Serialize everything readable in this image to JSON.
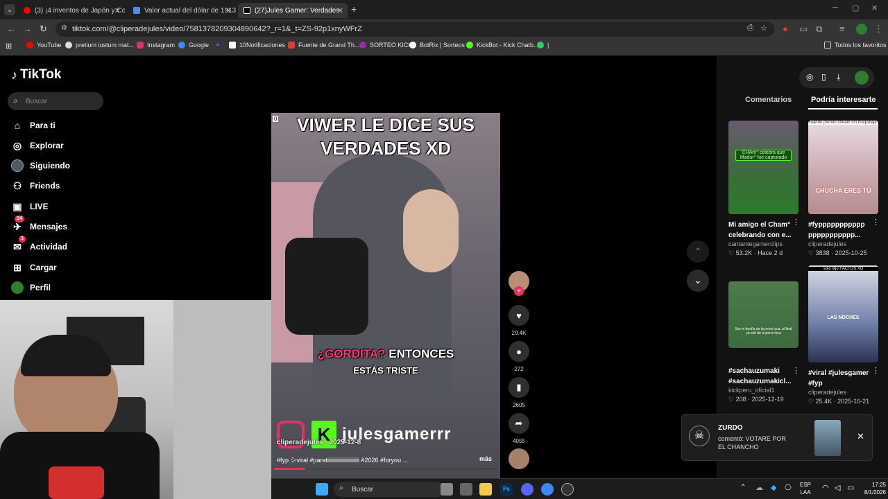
{
  "browser": {
    "tabs": [
      {
        "label": "(3) ¡4 inventos de Japón y Core",
        "color": "#ff0000"
      },
      {
        "label": "Valor actual del dólar de 1913",
        "color": "#4a90e2"
      },
      {
        "label": "(27)Jules Gamer: Verdades",
        "color": "#ffffff"
      }
    ],
    "url": "tiktok.com/@cliperadejules/video/7581378209304890642?_r=1&_t=ZS-92p1xnyWFrZ",
    "bookmarks": [
      {
        "label": "YouTube",
        "color": "#ff0000"
      },
      {
        "label": "pretium iustum mat...",
        "color": "#dddddd"
      },
      {
        "label": "Instagram",
        "color": "#e1306c"
      },
      {
        "label": "Google",
        "color": "#4285f4"
      },
      {
        "label": "10Notificaciones",
        "color": "#ffffff"
      },
      {
        "label": "Fuente de Grand Th...",
        "color": "#e53935"
      },
      {
        "label": "SORTEO KICK",
        "color": "#9c27b0"
      },
      {
        "label": "BotRix | Sorteos",
        "color": "#ffffff"
      },
      {
        "label": "KickBot - Kick Chatb...",
        "color": "#53fc18"
      }
    ],
    "all_favorites": "Todos los favoritos"
  },
  "tiktok": {
    "logo": "TikTok",
    "search_placeholder": "Buscar",
    "sidebar": [
      {
        "label": "Para ti",
        "icon": "home-icon"
      },
      {
        "label": "Explorar",
        "icon": "compass-icon"
      },
      {
        "label": "Siguiendo",
        "icon": "avatar-icon"
      },
      {
        "label": "Friends",
        "icon": "friends-icon"
      },
      {
        "label": "LIVE",
        "icon": "live-icon"
      },
      {
        "label": "Mensajes",
        "icon": "messages-icon",
        "badge": "24"
      },
      {
        "label": "Actividad",
        "icon": "activity-icon",
        "badge": "3"
      },
      {
        "label": "Cargar",
        "icon": "upload-icon"
      },
      {
        "label": "Perfil",
        "icon": "profile-icon"
      }
    ],
    "video": {
      "caption_top": "VIWER LE DICE SUS VERDADES XD",
      "caption_mid_accent": "¿GORDITA?",
      "caption_mid": "ENTONCES",
      "caption_sub": "ESTÁS TRISTE",
      "watermark": "julesgamerrr",
      "author": "cliperadejules · 2025-12-8",
      "description": "#fyp シviral #paratiiiiiiiiiiiiiiiiiiiiiii #2026 #foryou ...",
      "more": "más",
      "corner": "0"
    },
    "actions": {
      "likes": "29.4K",
      "comments": "272",
      "saves": "2605",
      "shares": "4055"
    },
    "panel": {
      "tab_comments": "Comentarios",
      "tab_interest": "Podría interesarte",
      "cards": [
        {
          "title": "Mi amigo el Cham° celebrando con e...",
          "author": "cantantegamerclips",
          "likes": "53.2K",
          "date": "Hace 2 d",
          "overlay": "CHAm° celebra que Madur° fue capturado"
        },
        {
          "title": "#fyppppppppppp ppppppppppp...",
          "author": "cliperadejules",
          "likes": "3838",
          "date": "2025-10-25",
          "overlay": "CHUCHA ERES TÚ",
          "top": "cuando prendo stream sin maquillaje:"
        },
        {
          "title": "#sachauzumaki #sachauzumakicl...",
          "author": "kickperu_oficial1",
          "likes": "208",
          "date": "2025-12-19",
          "overlay": "Soy el dueño de la perra loca, al final ya salí de la perra loca"
        },
        {
          "title": "#viral #julesgamer #fyp",
          "author": "cliperadejules",
          "likes": "25.4K",
          "date": "2025-10-21",
          "overlay": "LAS NOCHES",
          "top": "solo dijo FACTOS XD"
        }
      ]
    },
    "notification": {
      "name": "ZURDO",
      "text": "comentó: VOTARE POR EL CHANCHO"
    }
  },
  "taskbar": {
    "search": "Buscar",
    "lang": "ESP",
    "lang2": "LAA",
    "time": "17:25",
    "date": "8/1/2026"
  }
}
